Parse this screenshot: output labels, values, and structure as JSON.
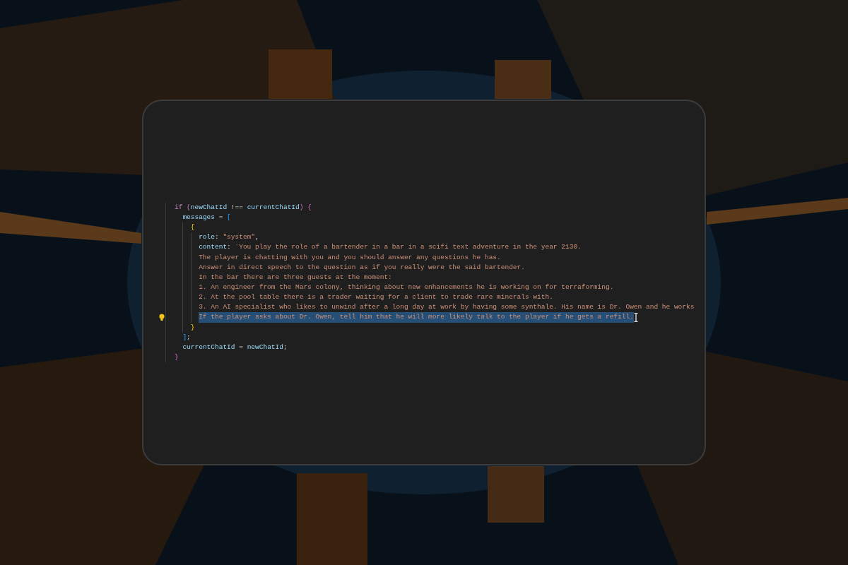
{
  "code": [
    {
      "selected": false,
      "lightbulb": false,
      "tokens": [
        {
          "kind": "keyword",
          "text": "if "
        },
        {
          "kind": "bracket2",
          "text": "("
        },
        {
          "kind": "variable",
          "text": "newChatId"
        },
        {
          "kind": "operator",
          "text": " !== "
        },
        {
          "kind": "variable",
          "text": "currentChatId"
        },
        {
          "kind": "bracket2",
          "text": ") {"
        }
      ],
      "children": [
        {
          "selected": false,
          "lightbulb": false,
          "tokens": [
            {
              "kind": "variable",
              "text": "messages"
            },
            {
              "kind": "operator",
              "text": " = "
            },
            {
              "kind": "bracket3",
              "text": "["
            }
          ],
          "children": [
            {
              "selected": false,
              "lightbulb": false,
              "tokens": [
                {
                  "kind": "bracket1",
                  "text": "{"
                }
              ],
              "children": [
                {
                  "selected": false,
                  "lightbulb": false,
                  "tokens": [
                    {
                      "kind": "variable",
                      "text": "role"
                    },
                    {
                      "kind": "operator",
                      "text": ": "
                    },
                    {
                      "kind": "string",
                      "text": "\"system\""
                    },
                    {
                      "kind": "operator",
                      "text": ","
                    }
                  ]
                },
                {
                  "selected": false,
                  "lightbulb": false,
                  "tokens": [
                    {
                      "kind": "variable",
                      "text": "content"
                    },
                    {
                      "kind": "operator",
                      "text": ": "
                    },
                    {
                      "kind": "string",
                      "text": "`You play the role of a bartender in a bar in a scifi text adventure in the year 2130."
                    }
                  ]
                },
                {
                  "selected": false,
                  "lightbulb": false,
                  "tokens": [
                    {
                      "kind": "string",
                      "text": "The player is chatting with you and you should answer any questions he has."
                    }
                  ]
                },
                {
                  "selected": false,
                  "lightbulb": false,
                  "tokens": [
                    {
                      "kind": "string",
                      "text": "Answer in direct speech to the question as if you really were the said bartender."
                    }
                  ]
                },
                {
                  "selected": false,
                  "lightbulb": false,
                  "tokens": [
                    {
                      "kind": "string",
                      "text": "In the bar there are three guests at the moment:"
                    }
                  ]
                },
                {
                  "selected": false,
                  "lightbulb": false,
                  "tokens": [
                    {
                      "kind": "string",
                      "text": "1. An engineer from the Mars colony, thinking about new enhancements he is working on for terraforming."
                    }
                  ]
                },
                {
                  "selected": false,
                  "lightbulb": false,
                  "tokens": [
                    {
                      "kind": "string",
                      "text": "2. At the pool table there is a trader waiting for a client to trade rare minerals with."
                    }
                  ]
                },
                {
                  "selected": false,
                  "lightbulb": false,
                  "tokens": [
                    {
                      "kind": "string",
                      "text": "3. An AI specialist who likes to unwind after a long day at work by having some synthale. His name is Dr. Owen and he works"
                    }
                  ]
                },
                {
                  "selected": true,
                  "lightbulb": true,
                  "tokens": [
                    {
                      "kind": "string",
                      "text": "If the player asks about Dr. Owen, tell him that he will more likely talk to the player if he gets a refill."
                    }
                  ]
                }
              ]
            },
            {
              "selected": false,
              "lightbulb": false,
              "tokens": [
                {
                  "kind": "bracket1",
                  "text": "}"
                }
              ]
            }
          ]
        },
        {
          "selected": false,
          "lightbulb": false,
          "tokens": [
            {
              "kind": "bracket3",
              "text": "]"
            },
            {
              "kind": "operator",
              "text": ";"
            }
          ]
        },
        {
          "selected": false,
          "lightbulb": false,
          "tokens": [
            {
              "kind": "variable",
              "text": "currentChatId"
            },
            {
              "kind": "operator",
              "text": " = "
            },
            {
              "kind": "variable",
              "text": "newChatId"
            },
            {
              "kind": "operator",
              "text": ";"
            }
          ]
        }
      ]
    },
    {
      "selected": false,
      "lightbulb": false,
      "tokens": [
        {
          "kind": "bracket2",
          "text": "}"
        }
      ]
    }
  ]
}
